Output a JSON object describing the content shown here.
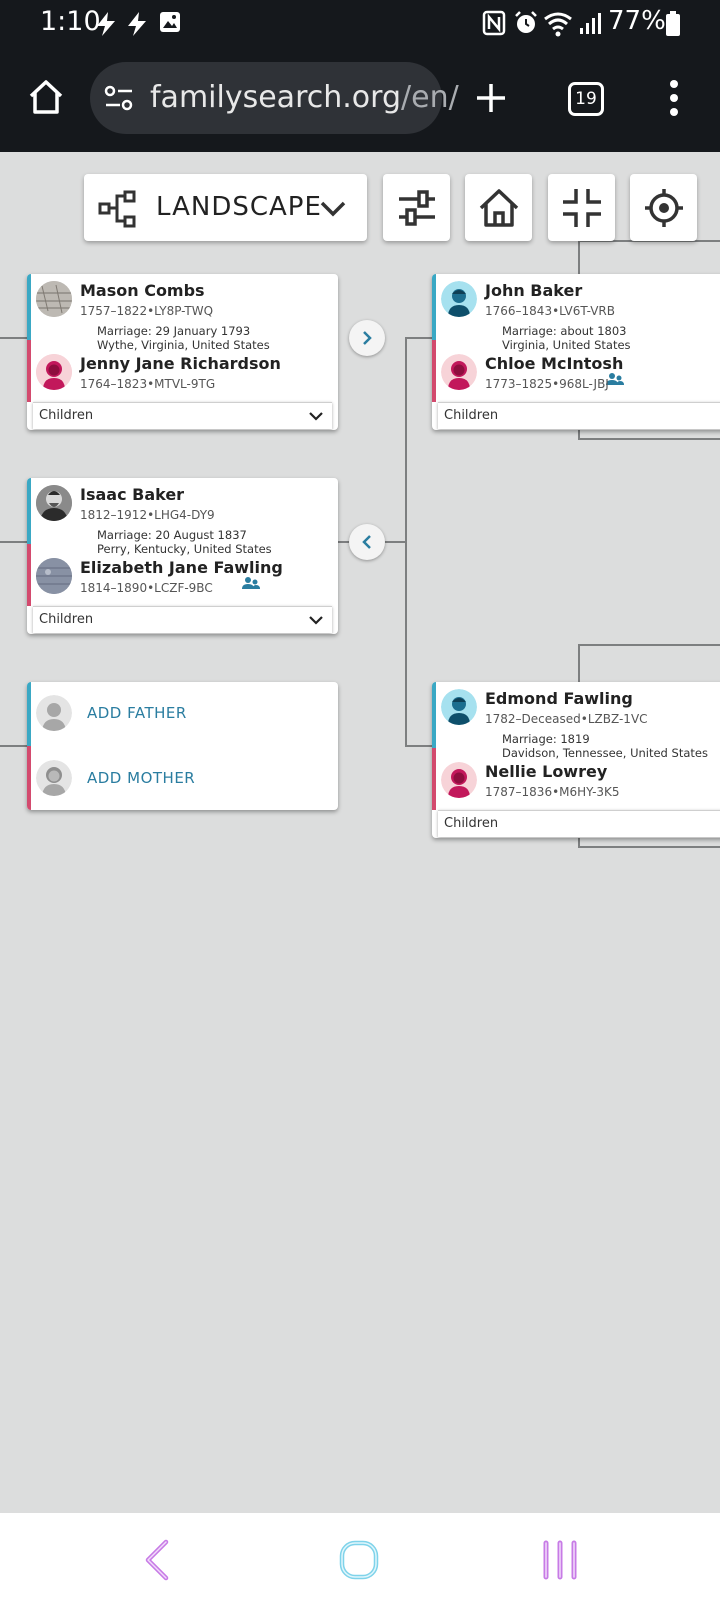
{
  "status_bar": {
    "time": "1:10",
    "battery": "77%"
  },
  "browser": {
    "url_domain": "familysearch.org",
    "url_path": "/en/",
    "tab_count": "19"
  },
  "toolbar": {
    "view_label": "LANDSCAPE"
  },
  "families": [
    {
      "father": {
        "name": "Mason Combs",
        "meta": "1757–1822•LY8P-TWQ"
      },
      "marriage": {
        "line1": "Marriage: 29 January 1793",
        "line2": "Wythe, Virginia, United States"
      },
      "mother": {
        "name": "Jenny Jane Richardson",
        "meta": "1764–1823•MTVL-9TG"
      },
      "children_label": "Children"
    },
    {
      "father": {
        "name": "Isaac Baker",
        "meta": "1812–1912•LHG4-DY9"
      },
      "marriage": {
        "line1": "Marriage: 20 August 1837",
        "line2": "Perry, Kentucky, United States"
      },
      "mother": {
        "name": "Elizabeth Jane Fawling",
        "meta": "1814–1890•LCZF-9BC"
      },
      "children_label": "Children"
    },
    {
      "add_father": "ADD FATHER",
      "add_mother": "ADD MOTHER"
    },
    {
      "father": {
        "name": "John Baker",
        "meta": "1766–1843•LV6T-VRB"
      },
      "marriage": {
        "line1": "Marriage: about 1803",
        "line2": "Virginia, United States"
      },
      "mother": {
        "name": "Chloe McIntosh",
        "meta": "1773–1825•968L-JBJ"
      },
      "children_label": "Children"
    },
    {
      "father": {
        "name": "Edmond Fawling",
        "meta": "1782–Deceased•LZBZ-1VC"
      },
      "marriage": {
        "line1": "Marriage: 1819",
        "line2": "Davidson, Tennessee, United States"
      },
      "mother": {
        "name": "Nellie Lowrey",
        "meta": "1787–1836•M6HY-3K5"
      },
      "children_label": "Children"
    }
  ],
  "colors": {
    "male_bar": "#3aa8c4",
    "female_bar": "#d34a6e",
    "link": "#2a7da0",
    "canvas": "#dcdddd"
  }
}
